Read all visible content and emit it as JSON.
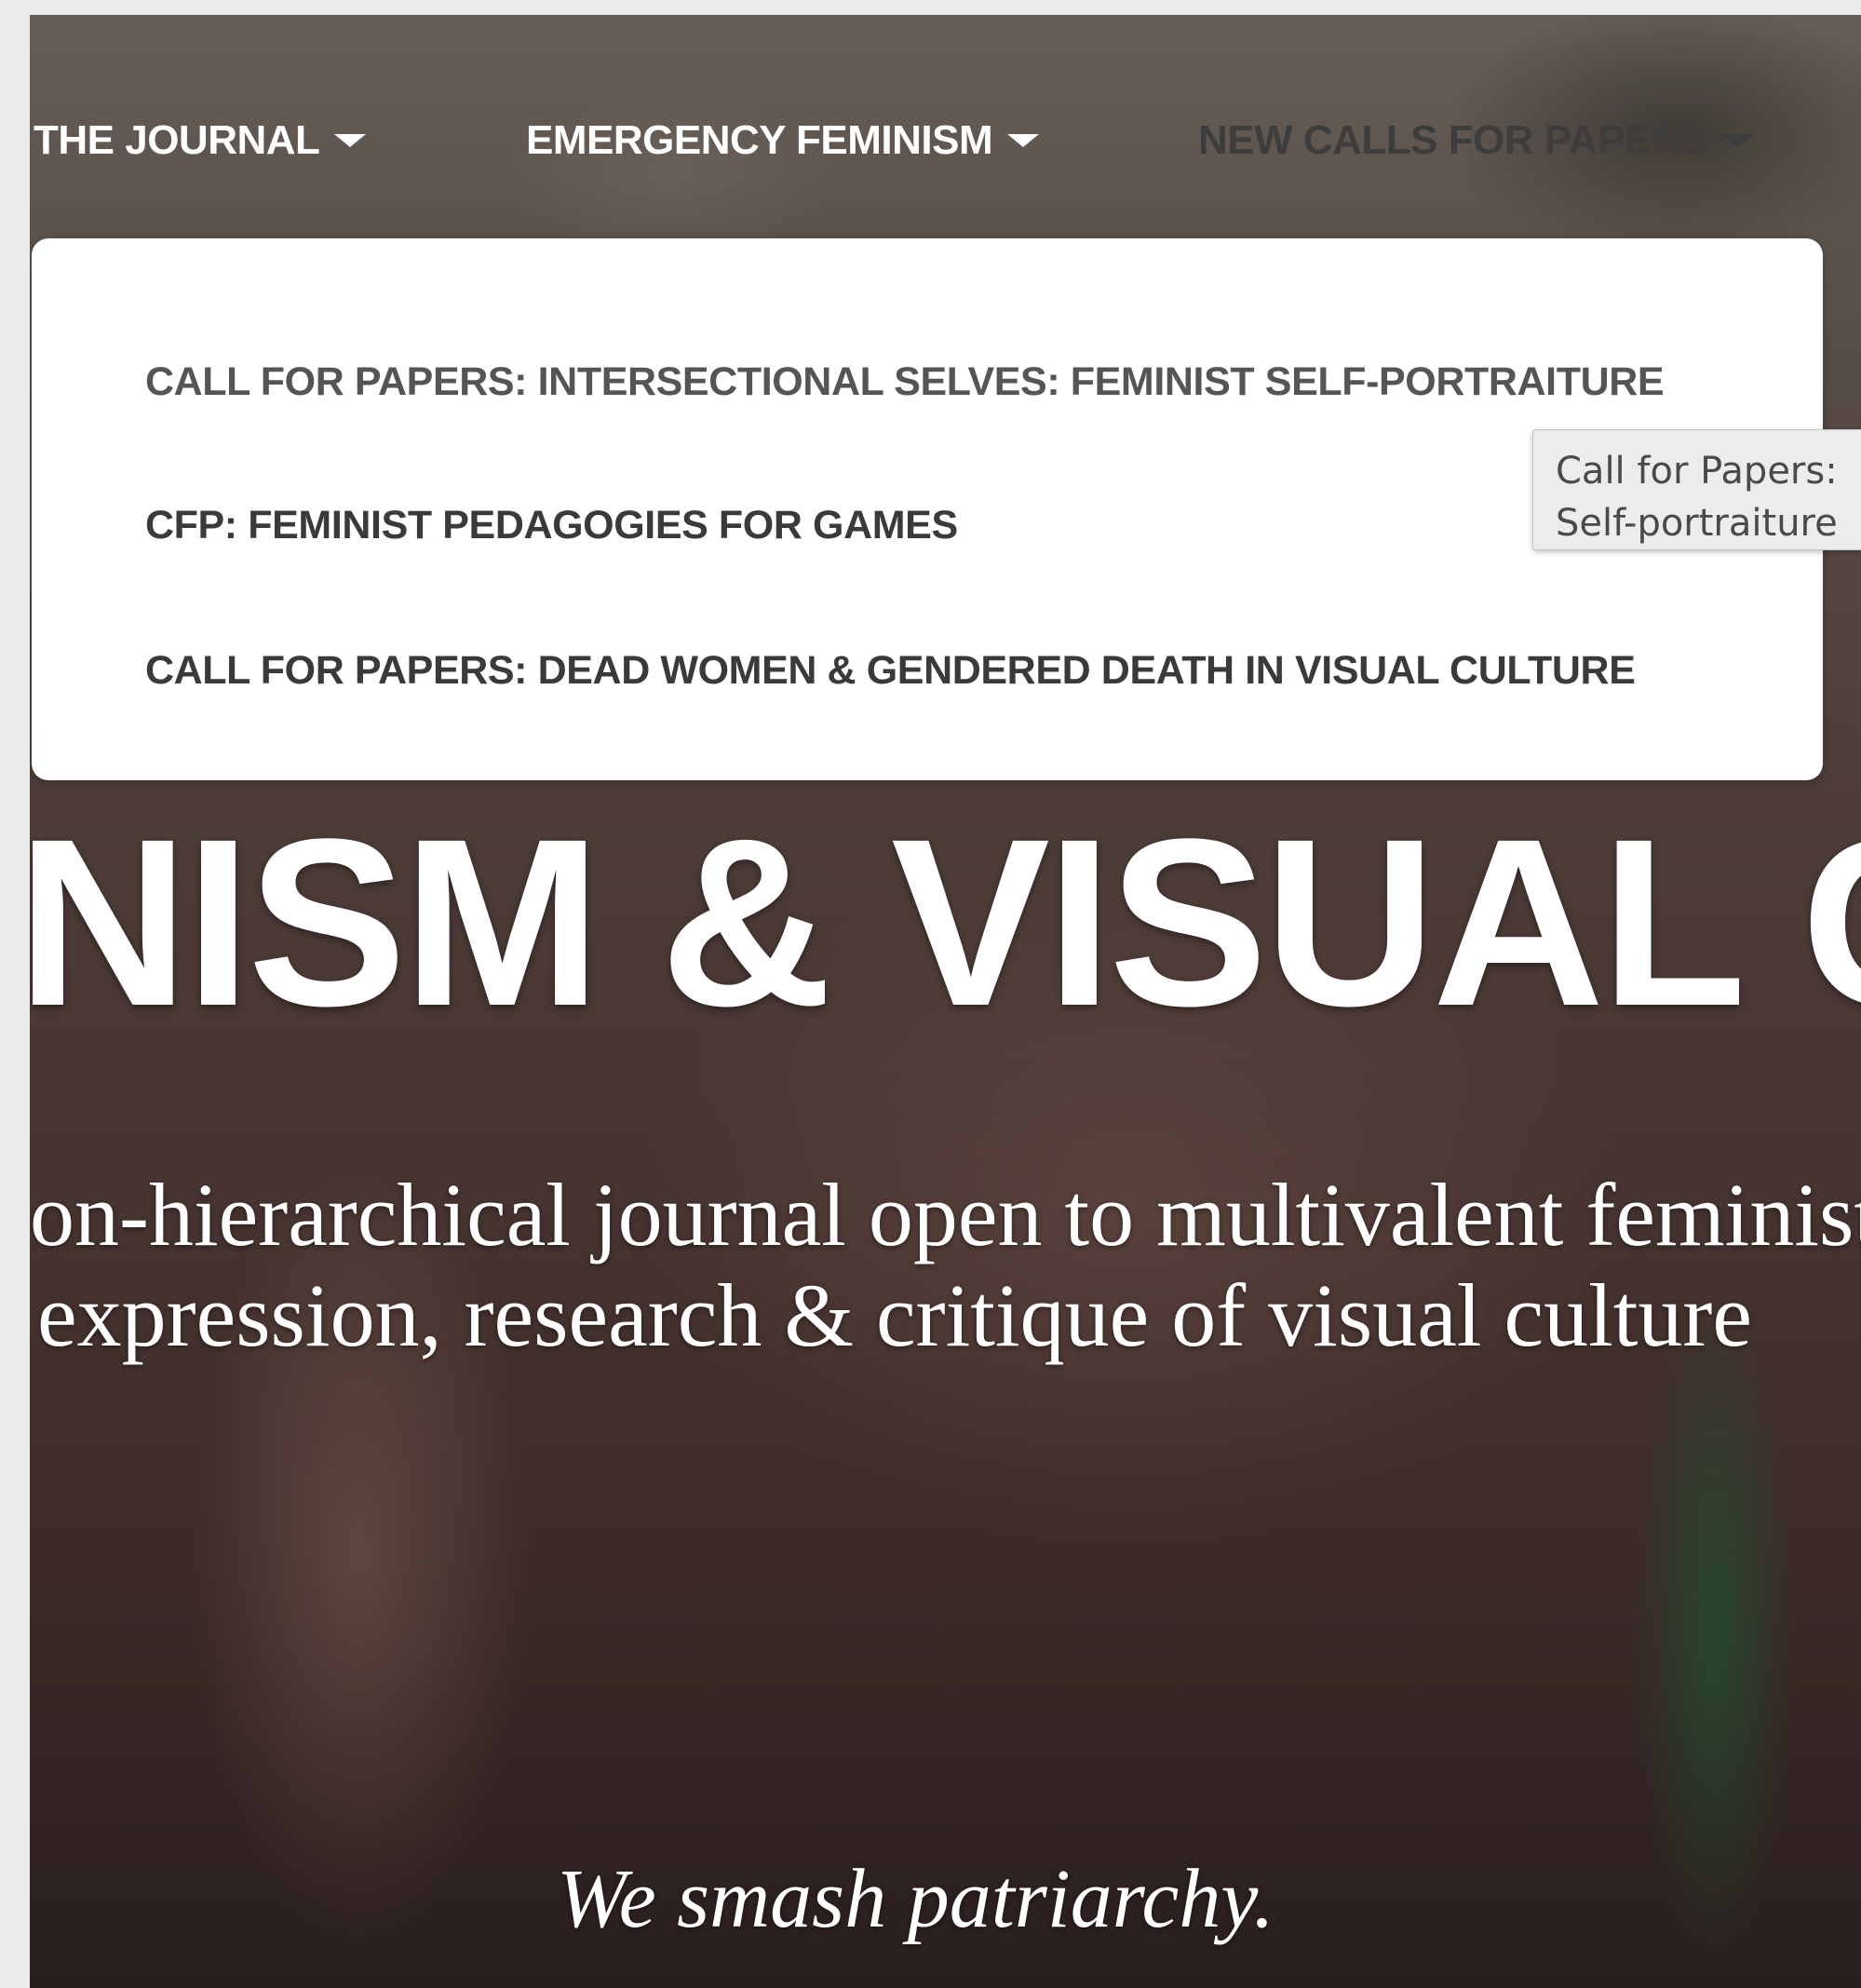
{
  "nav": {
    "items": [
      {
        "label": "THE JOURNAL"
      },
      {
        "label": "EMERGENCY FEMINISM"
      },
      {
        "label": "NEW CALLS FOR PAPERS"
      }
    ]
  },
  "dropdown": {
    "items": [
      {
        "label": "CALL FOR PAPERS: INTERSECTIONAL SELVES: FEMINIST SELF-PORTRAITURE"
      },
      {
        "label": "CFP: FEMINIST PEDAGOGIES FOR GAMES"
      },
      {
        "label": "CALL FOR PAPERS: DEAD WOMEN & GENDERED DEATH IN VISUAL CULTURE"
      }
    ]
  },
  "tooltip": {
    "line1": "Call for Papers:",
    "line2": "Self-portraiture"
  },
  "hero": {
    "title": "NISM & VISUAL C",
    "subtitle_line1": "on-hierarchical journal open to multivalent feminist",
    "subtitle_line2": "expression, research & critique of visual culture",
    "tagline": "We smash patriarchy."
  },
  "colors": {
    "nav_text": "#ffffff",
    "nav_text_dim": "#3d3d3d",
    "dropdown_bg": "#ffffff",
    "dropdown_text": "#3a3a3a",
    "tooltip_bg": "#ececec",
    "page_bg": "#e9eaec"
  }
}
